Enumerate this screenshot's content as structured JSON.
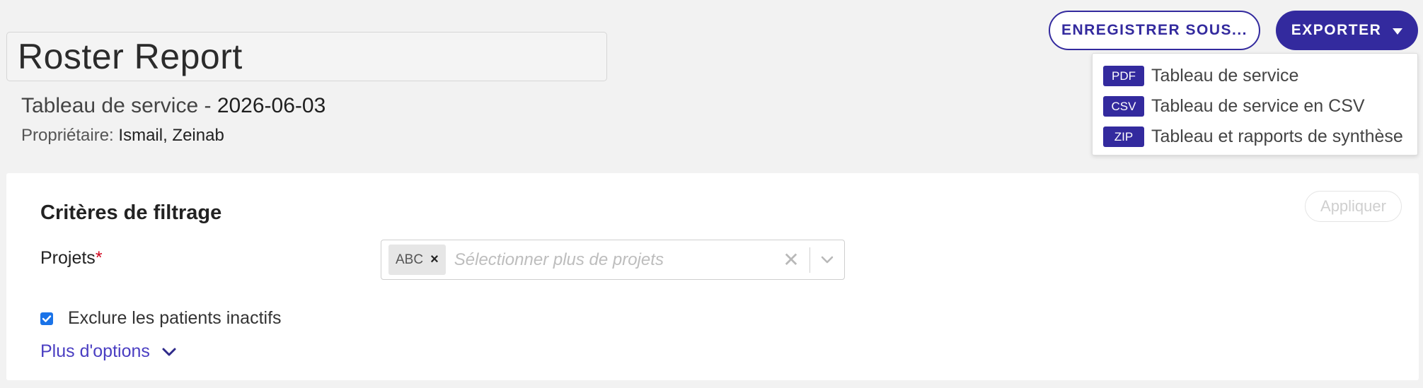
{
  "header": {
    "title": "Roster Report",
    "subtitle_prefix": "Tableau de service - ",
    "subtitle_date": "2026-06-03",
    "owner_label": "Propriétaire:",
    "owner_name": "Ismail, Zeinab"
  },
  "toolbar": {
    "save_as_label": "ENREGISTRER SOUS...",
    "export_label": "EXPORTER"
  },
  "export_menu": {
    "items": [
      {
        "badge": "PDF",
        "label": "Tableau de service"
      },
      {
        "badge": "CSV",
        "label": "Tableau de service en CSV"
      },
      {
        "badge": "ZIP",
        "label": "Tableau et rapports de synthèse"
      }
    ]
  },
  "filters": {
    "title": "Critères de filtrage",
    "apply_label": "Appliquer",
    "projects_label": "Projets",
    "required_marker": "*",
    "selected_project": "ABC",
    "chip_remove": "×",
    "projects_placeholder": "Sélectionner plus de projets",
    "clear_symbol": "✕",
    "exclude_inactive_label": "Exclure les patients inactifs",
    "exclude_inactive_checked": true,
    "more_options_label": "Plus d'options"
  },
  "colors": {
    "primary": "#332a9e",
    "link": "#4a3ec2",
    "checkbox": "#1a73e8",
    "required": "#d0021b"
  },
  "icons": {
    "export_caret": "caret-down-icon",
    "select_chevron": "chevron-down-icon",
    "more_chevron": "chevron-down-icon",
    "check": "check-icon"
  }
}
